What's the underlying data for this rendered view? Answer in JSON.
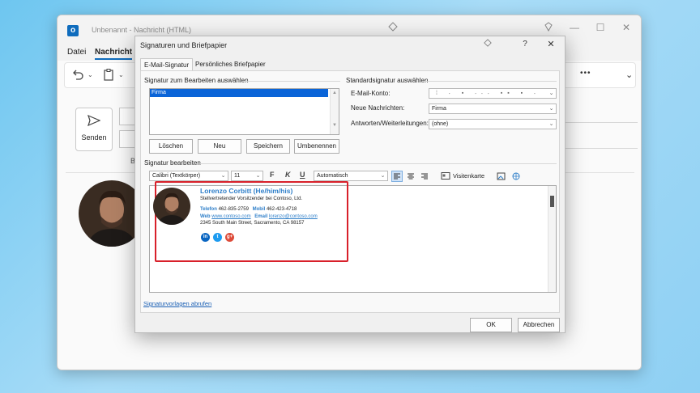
{
  "outlook": {
    "logo_letter": "o",
    "title": "Unbenannt  -  Nachricht (HTML)",
    "window_controls": {
      "minimize": "—",
      "maximize": "☐",
      "close": "✕"
    },
    "tabs": [
      "Datei",
      "Nachricht"
    ],
    "send_label": "Senden",
    "more_label": "•••",
    "partial_b": "B"
  },
  "dialog": {
    "title": "Signaturen und Briefpapier",
    "help": "?",
    "close": "✕",
    "tabs": {
      "email_signature": "E-Mail-Signatur",
      "stationery": "Persönliches Briefpapier"
    },
    "select_group": "Signatur zum Bearbeiten auswählen",
    "signatures": [
      "Firma"
    ],
    "buttons": {
      "delete": "Löschen",
      "new": "Neu",
      "save": "Speichern",
      "rename": "Umbenennen",
      "ok": "OK",
      "cancel": "Abbrechen"
    },
    "default_group": "Standardsignatur auswählen",
    "email_account_label": "E-Mail-Konto:",
    "new_messages_label": "Neue Nachrichten:",
    "new_messages_value": "Firma",
    "replies_label": "Antworten/Weiterleitungen:",
    "replies_value": "(ohne)",
    "edit_group": "Signatur bearbeiten",
    "font_name": "Calibri (Textkörper)",
    "font_size": "11",
    "bold": "F",
    "italic": "K",
    "underline": "U",
    "color_value": "Automatisch",
    "business_card": "Visitenkarte",
    "template_link": "Signaturvorlagen abrufen"
  },
  "signature": {
    "name": "Lorenzo Corbitt (He/him/his)",
    "role": "Stellvertretender Vorsitzender bei Contoso, Ltd.",
    "phone_label": "Telefon",
    "phone": "462-835-2759",
    "mobile_label": "Mobil",
    "mobile": "462-423-4718",
    "web_label": "Web",
    "web": "www.contoso.com",
    "email_label": "Email",
    "email": "lorenzo@contoso.com",
    "address": "2345 South Main Street, Sacramento, CA 98157",
    "social": [
      "in",
      "t",
      "g+"
    ]
  },
  "colors": {
    "accent": "#2f7fc9",
    "highlight": "#d8202a",
    "selection": "#0a64d8",
    "linkedin": "#0a66c2",
    "twitter": "#1d9bf0",
    "google": "#dd4b39"
  }
}
